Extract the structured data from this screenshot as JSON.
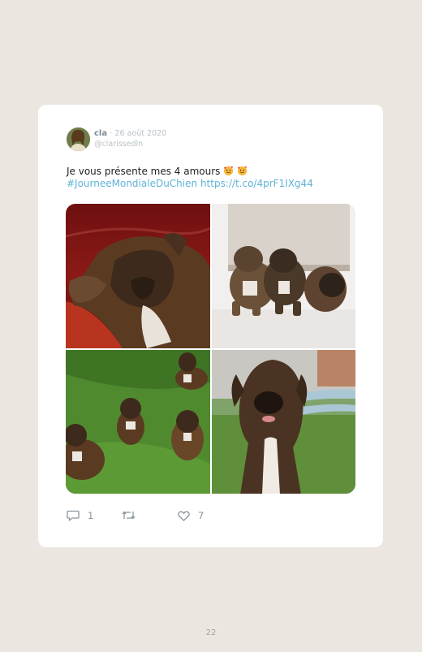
{
  "tweet": {
    "author_name": "cla",
    "separator": "·",
    "date": "26 août 2020",
    "handle": "@clarissedln",
    "text": "Je vous présente mes 4 amours",
    "hashtag": "#JourneeMondialeDuChien",
    "url": "https://t.co/4prF1IXg44",
    "emoji": "smiling-face-with-hearts x2",
    "photos": [
      {
        "icon": "puppy-sleeping-on-red-couch"
      },
      {
        "icon": "three-puppies-in-box"
      },
      {
        "icon": "puppies-on-lawn"
      },
      {
        "icon": "puppy-portrait-garden"
      }
    ]
  },
  "actions": {
    "reply_count": "1",
    "retweet_count": "",
    "like_count": "7"
  },
  "page": {
    "number": "22"
  }
}
